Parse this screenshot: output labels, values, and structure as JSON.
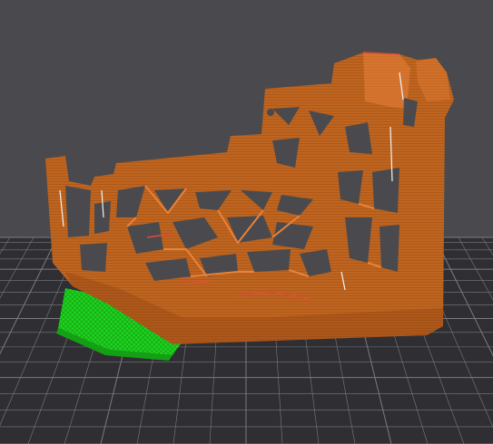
{
  "viewport": {
    "background_color": "#4a4a4e",
    "bed_color": "#2f2f33",
    "grid_line_color": "#7a7a80"
  },
  "model": {
    "shell_color": "#c0651f",
    "highlight_color": "#e8823a",
    "shadow_color": "#8a3f12",
    "support_color": "#1fd41f",
    "support_shadow_color": "#14a014",
    "edge_accent_color": "#e04a3a"
  }
}
